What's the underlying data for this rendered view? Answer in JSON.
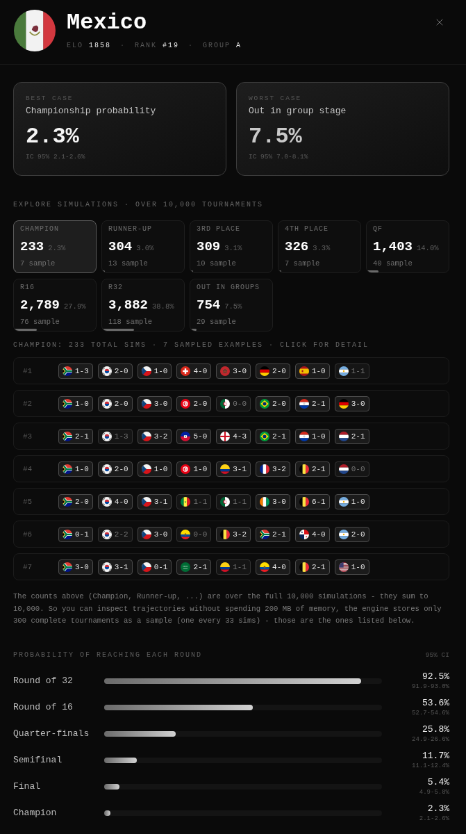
{
  "team": {
    "kind": "mx",
    "name": "Mexico",
    "separator": "·",
    "stats": [
      {
        "label": "ELO",
        "value": "1858"
      },
      {
        "label": "RANK",
        "value": "#19"
      },
      {
        "label": "GROUP",
        "value": "A"
      }
    ]
  },
  "summary_cards": [
    {
      "kind": "best",
      "label": "BEST CASE",
      "title": "Championship probability",
      "value": "2.3%",
      "interval": "IC 95% 2.1-2.6%"
    },
    {
      "kind": "worst",
      "label": "WORST CASE",
      "title": "Out in group stage",
      "value": "7.5%",
      "interval": "IC 95% 7.0-8.1%"
    }
  ],
  "simulations": {
    "heading": "EXPLORE SIMULATIONS · OVER 10,000 TOURNAMENTS",
    "tiles": [
      {
        "label": "CHAMPION",
        "count": "233",
        "percent": "2.3%",
        "samples": "7 sample",
        "level": 0.023,
        "selected": true
      },
      {
        "label": "RUNNER-UP",
        "count": "304",
        "percent": "3.0%",
        "samples": "13 sample",
        "level": 0.03,
        "selected": false
      },
      {
        "label": "3RD PLACE",
        "count": "309",
        "percent": "3.1%",
        "samples": "10 sample",
        "level": 0.031,
        "selected": false
      },
      {
        "label": "4TH PLACE",
        "count": "326",
        "percent": "3.3%",
        "samples": "7 sample",
        "level": 0.033,
        "selected": false
      },
      {
        "label": "QF",
        "count": "1,403",
        "percent": "14.0%",
        "samples": "40 sample",
        "level": 0.14,
        "selected": false
      },
      {
        "label": "R16",
        "count": "2,789",
        "percent": "27.9%",
        "samples": "76 sample",
        "level": 0.279,
        "selected": false
      },
      {
        "label": "R32",
        "count": "3,882",
        "percent": "38.8%",
        "samples": "118 sample",
        "level": 0.388,
        "selected": false
      },
      {
        "label": "OUT IN GROUPS",
        "count": "754",
        "percent": "7.5%",
        "samples": "29 sample",
        "level": 0.075,
        "selected": false
      }
    ]
  },
  "samples": {
    "heading": "CHAMPION: 233 TOTAL SIMS · 7 SAMPLED EXAMPLES · CLICK FOR DETAIL",
    "rows": [
      {
        "index": "#1",
        "matches": [
          {
            "kind": "za",
            "score": "1-3",
            "muted": false
          },
          {
            "kind": "kr",
            "score": "2-0",
            "muted": false
          },
          {
            "kind": "cz",
            "score": "1-0",
            "muted": false
          },
          {
            "kind": "ch",
            "score": "4-0",
            "muted": false
          },
          {
            "kind": "ma",
            "score": "3-0",
            "muted": false
          },
          {
            "kind": "de",
            "score": "2-0",
            "muted": false
          },
          {
            "kind": "es",
            "score": "1-0",
            "muted": false
          },
          {
            "kind": "ar",
            "score": "1-1",
            "muted": true
          }
        ]
      },
      {
        "index": "#2",
        "matches": [
          {
            "kind": "za",
            "score": "1-0",
            "muted": false
          },
          {
            "kind": "kr",
            "score": "2-0",
            "muted": false
          },
          {
            "kind": "cz",
            "score": "3-0",
            "muted": false
          },
          {
            "kind": "tn",
            "score": "2-0",
            "muted": false
          },
          {
            "kind": "dz",
            "score": "0-0",
            "muted": true
          },
          {
            "kind": "br",
            "score": "2-0",
            "muted": false
          },
          {
            "kind": "py",
            "score": "2-1",
            "muted": false
          },
          {
            "kind": "de",
            "score": "3-0",
            "muted": false
          }
        ]
      },
      {
        "index": "#3",
        "matches": [
          {
            "kind": "za",
            "score": "2-1",
            "muted": false
          },
          {
            "kind": "kr",
            "score": "1-3",
            "muted": true
          },
          {
            "kind": "cz",
            "score": "3-2",
            "muted": false
          },
          {
            "kind": "ht",
            "score": "5-0",
            "muted": false
          },
          {
            "kind": "en",
            "score": "4-3",
            "muted": false
          },
          {
            "kind": "br",
            "score": "2-1",
            "muted": false
          },
          {
            "kind": "py",
            "score": "1-0",
            "muted": false
          },
          {
            "kind": "nl",
            "score": "2-1",
            "muted": false
          }
        ]
      },
      {
        "index": "#4",
        "matches": [
          {
            "kind": "za",
            "score": "1-0",
            "muted": false
          },
          {
            "kind": "kr",
            "score": "2-0",
            "muted": false
          },
          {
            "kind": "cz",
            "score": "1-0",
            "muted": false
          },
          {
            "kind": "tn",
            "score": "1-0",
            "muted": false
          },
          {
            "kind": "co",
            "score": "3-1",
            "muted": false
          },
          {
            "kind": "fr",
            "score": "3-2",
            "muted": false
          },
          {
            "kind": "be",
            "score": "2-1",
            "muted": false
          },
          {
            "kind": "nl",
            "score": "0-0",
            "muted": true
          }
        ]
      },
      {
        "index": "#5",
        "matches": [
          {
            "kind": "za",
            "score": "2-0",
            "muted": false
          },
          {
            "kind": "kr",
            "score": "4-0",
            "muted": false
          },
          {
            "kind": "cz",
            "score": "3-1",
            "muted": false
          },
          {
            "kind": "sn",
            "score": "1-1",
            "muted": true
          },
          {
            "kind": "dz",
            "score": "1-1",
            "muted": true
          },
          {
            "kind": "ci",
            "score": "3-0",
            "muted": false
          },
          {
            "kind": "be",
            "score": "6-1",
            "muted": false
          },
          {
            "kind": "ar",
            "score": "1-0",
            "muted": false
          }
        ]
      },
      {
        "index": "#6",
        "matches": [
          {
            "kind": "za",
            "score": "0-1",
            "muted": false
          },
          {
            "kind": "kr",
            "score": "2-2",
            "muted": true
          },
          {
            "kind": "cz",
            "score": "3-0",
            "muted": false
          },
          {
            "kind": "ec",
            "score": "0-0",
            "muted": true
          },
          {
            "kind": "be",
            "score": "3-2",
            "muted": false
          },
          {
            "kind": "za",
            "score": "2-1",
            "muted": false
          },
          {
            "kind": "pa",
            "score": "4-0",
            "muted": false
          },
          {
            "kind": "ar",
            "score": "2-0",
            "muted": false
          }
        ]
      },
      {
        "index": "#7",
        "matches": [
          {
            "kind": "za",
            "score": "3-0",
            "muted": false
          },
          {
            "kind": "kr",
            "score": "3-1",
            "muted": false
          },
          {
            "kind": "cz",
            "score": "0-1",
            "muted": false
          },
          {
            "kind": "sa",
            "score": "2-1",
            "muted": false
          },
          {
            "kind": "co",
            "score": "1-1",
            "muted": true
          },
          {
            "kind": "ec",
            "score": "4-0",
            "muted": false
          },
          {
            "kind": "be",
            "score": "2-1",
            "muted": false
          },
          {
            "kind": "us",
            "score": "1-0",
            "muted": false
          }
        ]
      }
    ]
  },
  "note": "The counts above (Champion, Runner-up, ...) are over the full 10,000 simulations - they sum to 10,000. So you can inspect trajectories without spending 200 MB of memory, the engine stores only 300 complete tournaments as a sample (one every 33 sims) - those are the ones listed below.",
  "round_probabilities": {
    "heading": "PROBABILITY OF REACHING EACH ROUND",
    "ci_label": "95% CI",
    "rows": [
      {
        "label": "Round of 32",
        "level": 0.925,
        "value": "92.5%",
        "interval": "91.9-93.0%"
      },
      {
        "label": "Round of 16",
        "level": 0.536,
        "value": "53.6%",
        "interval": "52.7-54.6%"
      },
      {
        "label": "Quarter-finals",
        "level": 0.258,
        "value": "25.8%",
        "interval": "24.9-26.6%"
      },
      {
        "label": "Semifinal",
        "level": 0.117,
        "value": "11.7%",
        "interval": "11.1-12.4%"
      },
      {
        "label": "Final",
        "level": 0.054,
        "value": "5.4%",
        "interval": "4.9-5.8%"
      },
      {
        "label": "Champion",
        "level": 0.023,
        "value": "2.3%",
        "interval": "2.1-2.6%"
      }
    ]
  }
}
